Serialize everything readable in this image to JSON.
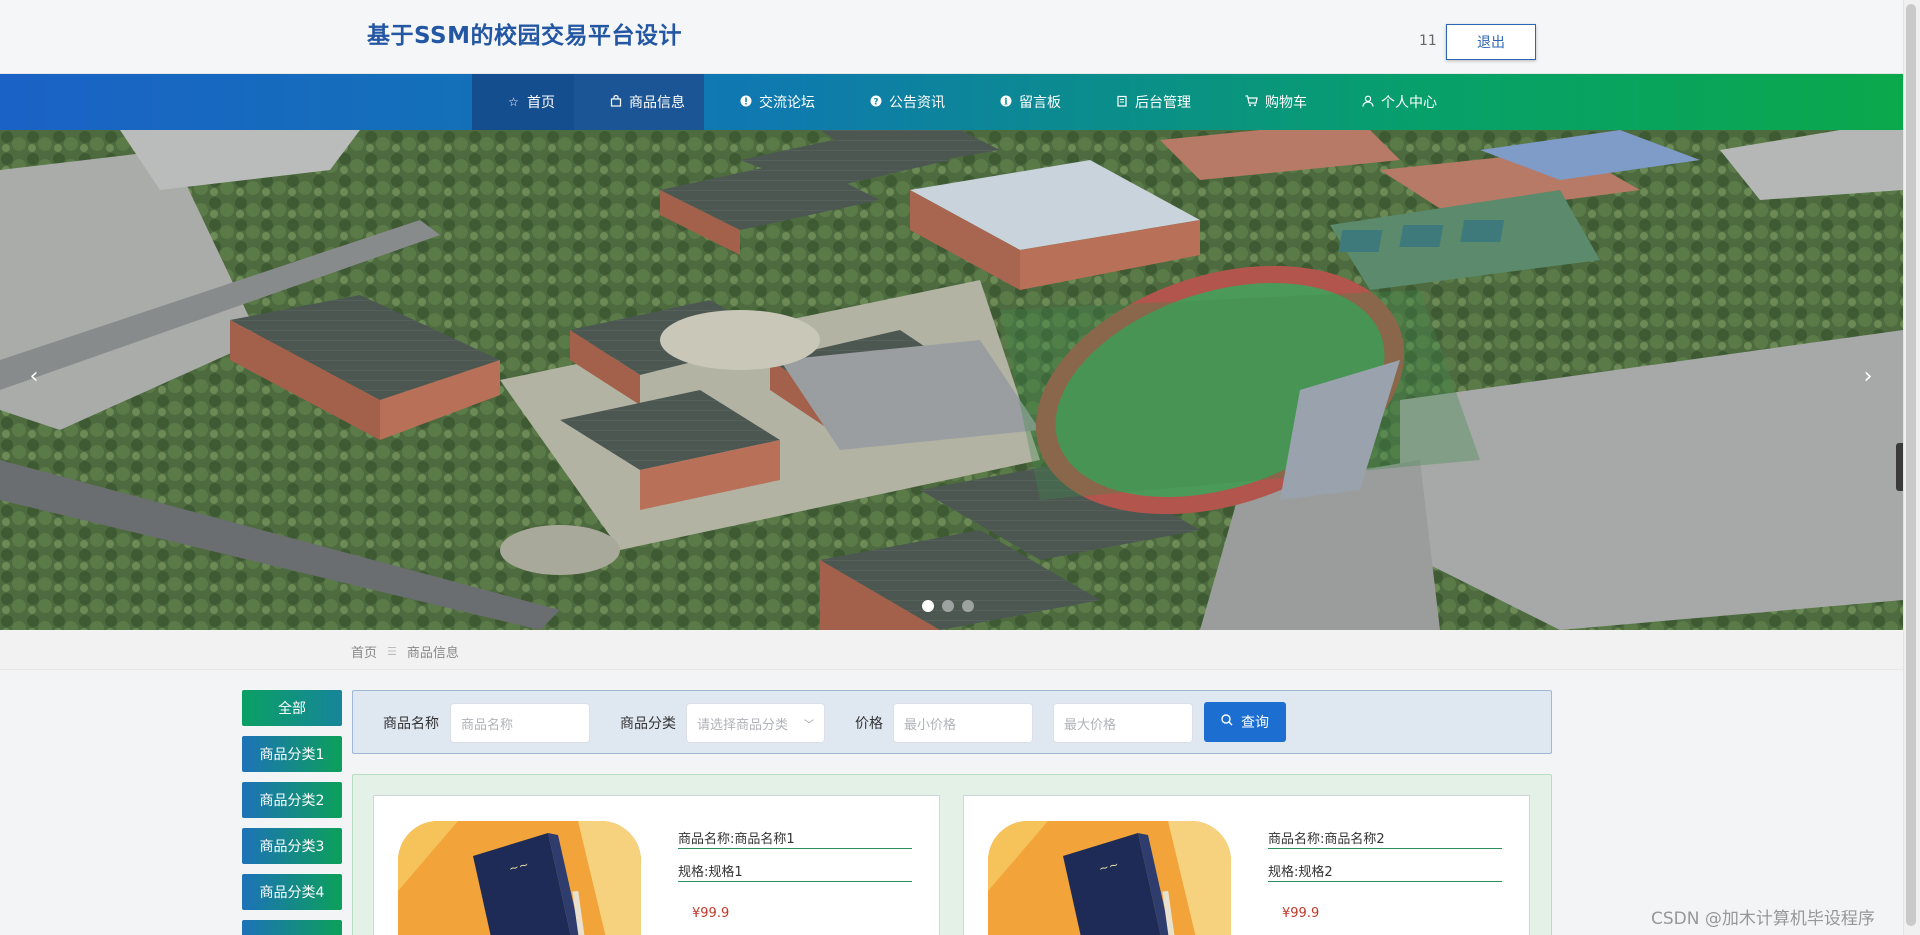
{
  "header": {
    "title": "基于SSM的校园交易平台设计",
    "user_name": "11",
    "logout_label": "退出"
  },
  "nav": {
    "items": [
      {
        "icon": "star-icon",
        "label": "首页"
      },
      {
        "icon": "bag-icon",
        "label": "商品信息"
      },
      {
        "icon": "info-icon",
        "label": "交流论坛"
      },
      {
        "icon": "question-icon",
        "label": "公告资讯"
      },
      {
        "icon": "info-icon",
        "label": "留言板"
      },
      {
        "icon": "building-icon",
        "label": "后台管理"
      },
      {
        "icon": "cart-icon",
        "label": "购物车"
      },
      {
        "icon": "user-icon",
        "label": "个人中心"
      }
    ],
    "active_index": 1
  },
  "banner": {
    "prev": "‹",
    "next": "›",
    "dots": 3,
    "active_dot": 0
  },
  "breadcrumb": {
    "home": "首页",
    "current": "商品信息"
  },
  "categories": [
    "全部",
    "商品分类1",
    "商品分类2",
    "商品分类3",
    "商品分类4"
  ],
  "search": {
    "name_label": "商品名称",
    "name_placeholder": "商品名称",
    "cat_label": "商品分类",
    "cat_placeholder": "请选择商品分类",
    "price_label": "价格",
    "min_placeholder": "最小价格",
    "max_placeholder": "最大价格",
    "query_label": "查询"
  },
  "products": [
    {
      "name": "商品名称:商品名称1",
      "spec": "规格:规格1",
      "price": "¥99.9"
    },
    {
      "name": "商品名称:商品名称2",
      "spec": "规格:规格2",
      "price": "¥99.9"
    }
  ],
  "watermark": "CSDN @加木计算机毕设程序",
  "colors": {
    "brand": "#2457a3",
    "nav_start": "#1a62c6",
    "nav_end": "#0ba84c",
    "price": "#c0392b"
  }
}
